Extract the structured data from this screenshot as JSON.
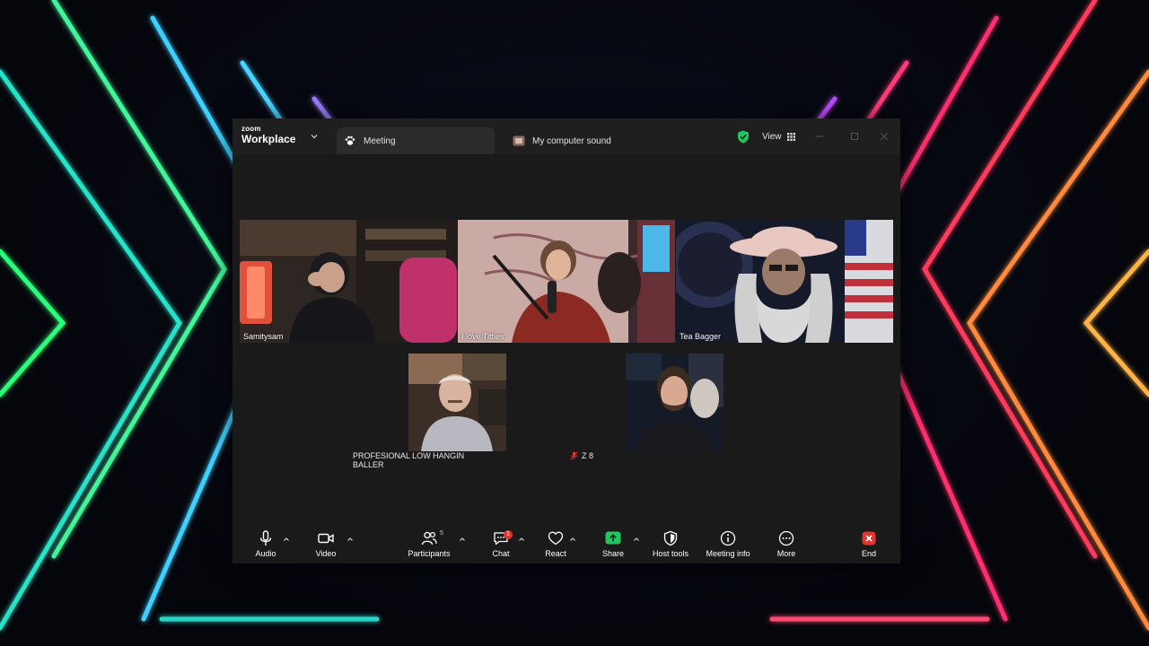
{
  "app": {
    "brand_top": "zoom",
    "brand_bottom": "Workplace"
  },
  "tabs": [
    {
      "label": "Meeting",
      "icon": "paw-icon"
    },
    {
      "label": "My computer sound",
      "icon": "speaker-thumbnail-icon"
    }
  ],
  "header": {
    "view_label": "View",
    "security_status": "shield-check-icon"
  },
  "participants": [
    {
      "name": "Samitysam",
      "active_speaker": true
    },
    {
      "name": "I love Titties",
      "active_speaker": false
    },
    {
      "name": "Tea Bagger",
      "active_speaker": false
    },
    {
      "name": "PROFESIONAL LOW HANGIN BALLER",
      "active_speaker": false
    },
    {
      "name": "Z 8",
      "muted": true
    }
  ],
  "toolbar": {
    "audio": "Audio",
    "video": "Video",
    "participants": "Participants",
    "participants_count": "5",
    "chat": "Chat",
    "chat_unread": "1",
    "react": "React",
    "share": "Share",
    "host_tools": "Host tools",
    "meeting_info": "Meeting info",
    "more": "More",
    "end": "End"
  },
  "colors": {
    "active_speaker": "#2bd67b",
    "share": "#22c55e",
    "end": "#e5322d",
    "badge": "#e5322d"
  }
}
